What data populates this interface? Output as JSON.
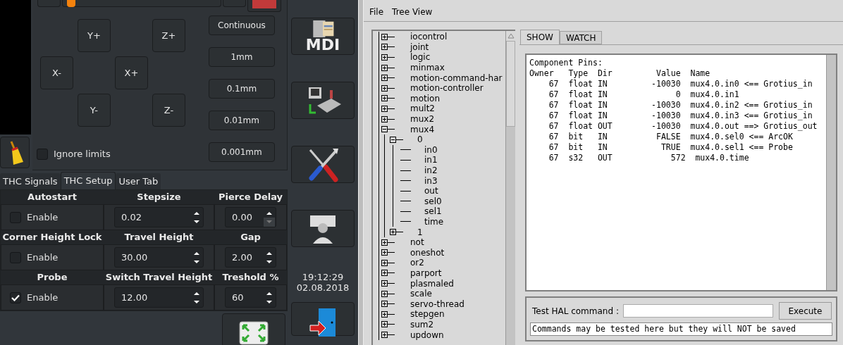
{
  "top_bar": {
    "slider": {
      "level": 0.03
    }
  },
  "jog": {
    "axis_buttons": [
      {
        "label": "Y+"
      },
      {
        "label": "Z+"
      },
      {
        "label": "X-"
      },
      {
        "label": "X+"
      },
      {
        "label": "Y-"
      },
      {
        "label": "Z-"
      }
    ],
    "ignore_limits": {
      "label": "Ignore limits",
      "checked": false
    },
    "step_buttons": [
      {
        "label": "Continuous"
      },
      {
        "label": "1mm"
      },
      {
        "label": "0.1mm"
      },
      {
        "label": "0.01mm"
      },
      {
        "label": "0.001mm"
      }
    ]
  },
  "side_buttons": [
    {
      "kind": "mdi",
      "label": "MDI"
    },
    {
      "kind": "machine"
    },
    {
      "kind": "tools"
    },
    {
      "kind": "operator"
    }
  ],
  "clock": {
    "time": "19:12:29",
    "date": "02.08.2018"
  },
  "thc_tabs": [
    {
      "label": "THC Signals",
      "selected": false
    },
    {
      "label": "THC Setup",
      "selected": true
    },
    {
      "label": "User Tab",
      "selected": false
    }
  ],
  "thc_setup": [
    [
      {
        "kind": "checkbox",
        "title": "Autostart",
        "label": "Enable",
        "checked": false
      },
      {
        "kind": "spin",
        "title": "Stepsize",
        "value": "0.02",
        "down_disabled": false
      },
      {
        "kind": "spin",
        "title": "Pierce Delay",
        "value": "0.00",
        "down_disabled": true
      }
    ],
    [
      {
        "kind": "checkbox",
        "title": "Corner Height Lock",
        "label": "Enable",
        "checked": false
      },
      {
        "kind": "spin",
        "title": "Travel Height",
        "value": "30.00",
        "down_disabled": false
      },
      {
        "kind": "spin",
        "title": "Gap",
        "value": "2.00",
        "down_disabled": false
      }
    ],
    [
      {
        "kind": "checkbox",
        "title": "Probe",
        "label": "Enable",
        "checked": true
      },
      {
        "kind": "spin",
        "title": "Switch Travel Height",
        "value": "12.00",
        "down_disabled": false
      },
      {
        "kind": "spin",
        "title": "Treshold %",
        "value": "60",
        "down_disabled": false
      }
    ]
  ],
  "halshow": {
    "menu": [
      "File",
      "Tree View"
    ],
    "tree": [
      {
        "label": "iocontrol",
        "expanded": false
      },
      {
        "label": "joint",
        "expanded": false
      },
      {
        "label": "logic",
        "expanded": false
      },
      {
        "label": "minmax",
        "expanded": false
      },
      {
        "label": "motion-command-har",
        "expanded": false
      },
      {
        "label": "motion-controller",
        "expanded": false
      },
      {
        "label": "motion",
        "expanded": false
      },
      {
        "label": "mult2",
        "expanded": false
      },
      {
        "label": "mux2",
        "expanded": false
      },
      {
        "label": "mux4",
        "expanded": true,
        "children": [
          {
            "label": "0",
            "expanded": true,
            "children": [
              {
                "label": "in0"
              },
              {
                "label": "in1"
              },
              {
                "label": "in2"
              },
              {
                "label": "in3"
              },
              {
                "label": "out"
              },
              {
                "label": "sel0"
              },
              {
                "label": "sel1"
              },
              {
                "label": "time"
              }
            ]
          },
          {
            "label": "1",
            "expanded": false
          }
        ]
      },
      {
        "label": "not",
        "expanded": false
      },
      {
        "label": "oneshot",
        "expanded": false
      },
      {
        "label": "or2",
        "expanded": false
      },
      {
        "label": "parport",
        "expanded": false
      },
      {
        "label": "plasmaled",
        "expanded": false
      },
      {
        "label": "scale",
        "expanded": false
      },
      {
        "label": "servo-thread",
        "expanded": false
      },
      {
        "label": "stepgen",
        "expanded": false
      },
      {
        "label": "sum2",
        "expanded": false
      },
      {
        "label": "updown",
        "expanded": false
      }
    ],
    "tabs": [
      {
        "label": "SHOW",
        "selected": true
      },
      {
        "label": "WATCH",
        "selected": false
      }
    ],
    "output": [
      "Component Pins:",
      "Owner   Type  Dir         Value  Name",
      "    67  float IN         -10030  mux4.0.in0 <== Grotius_in",
      "    67  float IN              0  mux4.0.in1",
      "    67  float IN         -10030  mux4.0.in2 <== Grotius_in",
      "    67  float IN         -10030  mux4.0.in3 <== Grotius_in",
      "    67  float OUT        -10030  mux4.0.out ==> Grotius_out",
      "    67  bit   IN          FALSE  mux4.0.sel0 <== ArcOK",
      "    67  bit   IN           TRUE  mux4.0.sel1 <== Probe",
      "    67  s32   OUT            572  mux4.0.time"
    ],
    "test": {
      "label": "Test HAL command :",
      "button": "Execute",
      "message": "Commands may be tested here but they will NOT be saved"
    }
  }
}
